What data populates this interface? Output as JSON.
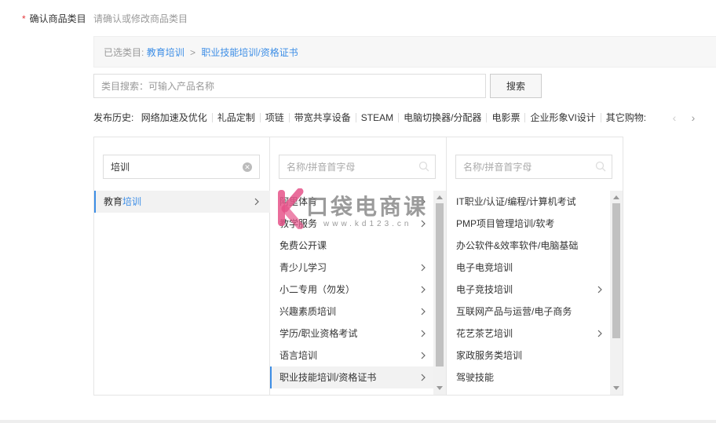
{
  "form": {
    "star": "*",
    "label": "确认商品类目",
    "hint": "请确认或修改商品类目"
  },
  "selected": {
    "prefix": "已选类目:",
    "path1": "教育培训",
    "sep": ">",
    "path2": "职业技能培训/资格证书"
  },
  "search": {
    "placeholder": "类目搜索：可输入产品名称",
    "button": "搜索"
  },
  "history": {
    "label": "发布历史:",
    "items": [
      "网络加速及优化",
      "礼品定制",
      "项链",
      "带宽共享设备",
      "STEAM",
      "电脑切换器/分配器",
      "电影票",
      "企业形象VI设计",
      "其它购物:"
    ]
  },
  "col1": {
    "search_value": "培训",
    "items": [
      {
        "pre": "教育",
        "hl": "培训",
        "has_children": true,
        "active": true
      }
    ]
  },
  "col2": {
    "placeholder": "名称/拼音首字母",
    "items": [
      {
        "label": "阿里体育",
        "has_children": true
      },
      {
        "label": "教学服务",
        "has_children": true
      },
      {
        "label": "免费公开课",
        "has_children": false
      },
      {
        "label": "青少儿学习",
        "has_children": true
      },
      {
        "label": "小二专用（勿发）",
        "has_children": true
      },
      {
        "label": "兴趣素质培训",
        "has_children": true
      },
      {
        "label": "学历/职业资格考试",
        "has_children": true
      },
      {
        "label": "语言培训",
        "has_children": true
      },
      {
        "label": "职业技能培训/资格证书",
        "has_children": true,
        "active": true
      }
    ]
  },
  "col3": {
    "placeholder": "名称/拼音首字母",
    "items": [
      {
        "label": "IT职业/认证/编程/计算机考试",
        "has_children": false
      },
      {
        "label": "PMP项目管理培训/软考",
        "has_children": false
      },
      {
        "label": "办公软件&效率软件/电脑基础",
        "has_children": false
      },
      {
        "label": "电子电竞培训",
        "has_children": false
      },
      {
        "label": "电子竞技培训",
        "has_children": true
      },
      {
        "label": "互联网产品与运营/电子商务",
        "has_children": false
      },
      {
        "label": "花艺茶艺培训",
        "has_children": true
      },
      {
        "label": "家政服务类培训",
        "has_children": false
      },
      {
        "label": "驾驶技能",
        "has_children": false
      }
    ]
  },
  "watermark": {
    "text": "口袋电商课",
    "url": "www.kd123.cn"
  },
  "colors": {
    "accent": "#3d8ee6",
    "required": "#e4393c",
    "watermark_k": "#e6548a"
  }
}
